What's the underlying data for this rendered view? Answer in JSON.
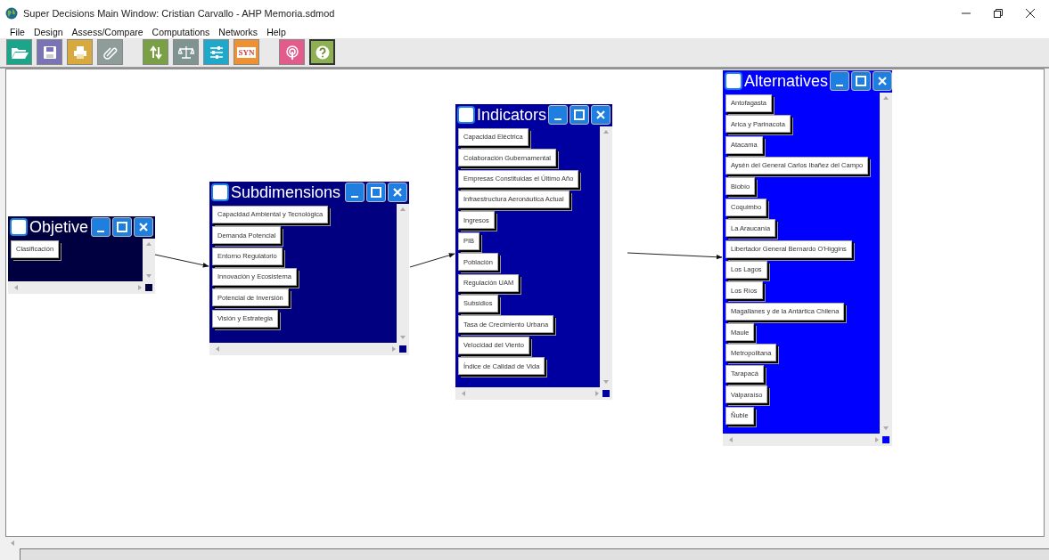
{
  "window": {
    "title": "Super Decisions Main Window: Cristian Carvallo - AHP Memoria.sdmod"
  },
  "menu": [
    "File",
    "Design",
    "Assess/Compare",
    "Computations",
    "Networks",
    "Help"
  ],
  "toolbar": [
    {
      "kind": "open"
    },
    {
      "kind": "save"
    },
    {
      "kind": "print"
    },
    {
      "kind": "attach"
    },
    {
      "kind": "update"
    },
    {
      "kind": "scale"
    },
    {
      "kind": "sliders"
    },
    {
      "kind": "syn"
    },
    {
      "kind": "broadcast"
    },
    {
      "kind": "help"
    }
  ],
  "syn_label": "SYN",
  "clusters": [
    {
      "name": "Objetive",
      "color": "#000040",
      "nodes": [
        "Clasificación"
      ]
    },
    {
      "name": "Subdimensions",
      "color": "#000080",
      "nodes": [
        "Capacidad Ambiental y Tecnológica",
        "Demanda Potencial",
        "Entorno Regulatorio",
        "Innovación y Ecosistema",
        "Potencial de Inversión",
        "Visión y Estrategia"
      ]
    },
    {
      "name": "Indicators",
      "color": "#0000a0",
      "nodes": [
        "Capacidad Eléctrica",
        "Colaboración Gubernamental",
        "Empresas Constituidas el Último Año",
        "Infraestructura Aeronáutica Actual",
        "Ingresos",
        "PIB",
        "Población",
        "Regulación UAM",
        "Subsidios",
        "Tasa de Crecimiento Urbana",
        "Velocidad del Viento",
        "Índice de Calidad de Vida"
      ]
    },
    {
      "name": "Alternatives",
      "color": "#0000ff",
      "nodes": [
        "Antofagasta",
        "Arica y Parinacota",
        "Atacama",
        "Aysén del General Carlos Ibañez del Campo",
        "Biobío",
        "Coquimbo",
        "La Araucanía",
        "Libertador General Bernardo O'Higgins",
        "Los Lagos",
        "Los Ríos",
        "Magallanes y de la Antártica Chilena",
        "Maule",
        "Metropolitana",
        "Tarapacá",
        "Valparaíso",
        "Ñuble"
      ]
    }
  ]
}
